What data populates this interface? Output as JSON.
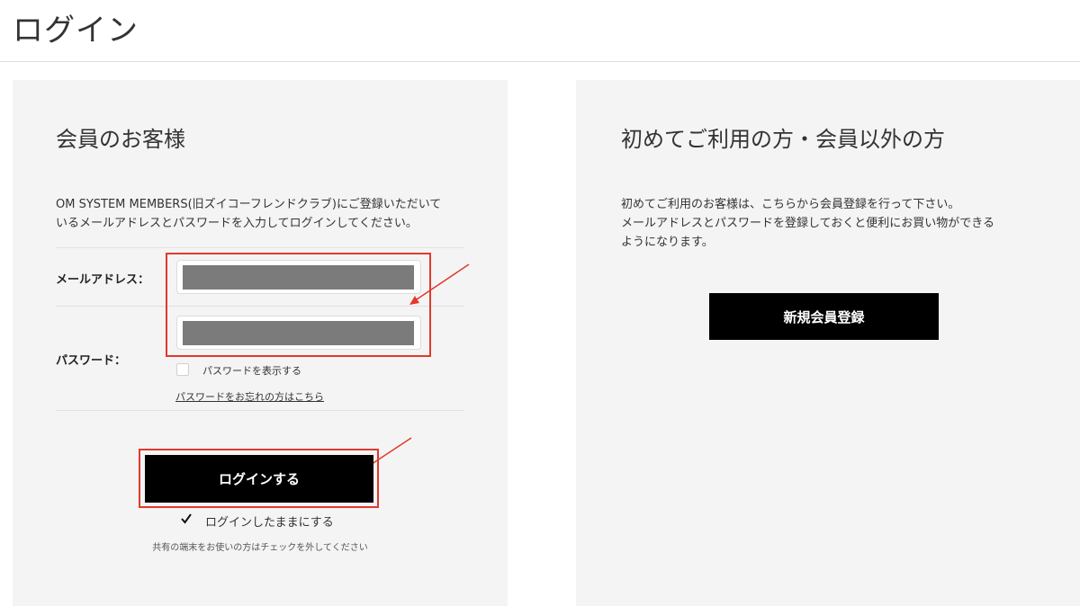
{
  "page": {
    "title": "ログイン"
  },
  "member_panel": {
    "heading": "会員のお客様",
    "description": "OM SYSTEM MEMBERS(旧ズイコーフレンドクラブ)にご登録いただいて\nいるメールアドレスとパスワードを入力してログインしてください。",
    "email_label": "メールアドレス：",
    "email_value": "",
    "password_label": "パスワード：",
    "password_value": "",
    "show_password_label": "パスワードを表示する",
    "show_password_checked": false,
    "forgot_password_link": "パスワードをお忘れの方はこちら",
    "login_button": "ログインする",
    "remember_label": "ログインしたままにする",
    "remember_checked": true,
    "remember_note": "共有の端末をお使いの方はチェックを外してください"
  },
  "guest_panel": {
    "heading": "初めてご利用の方・会員以外の方",
    "description": "初めてご利用のお客様は、こちらから会員登録を行って下さい。\nメールアドレスとパスワードを登録しておくと便利にお買い物ができる\nようになります。",
    "register_button": "新規会員登録"
  },
  "colors": {
    "annotation": "#e03a2c",
    "panel_background": "#f4f4f4",
    "button_background": "#000000"
  },
  "icons": {
    "checkbox_checked": "check-icon",
    "annotation_arrow": "arrow-icon"
  }
}
